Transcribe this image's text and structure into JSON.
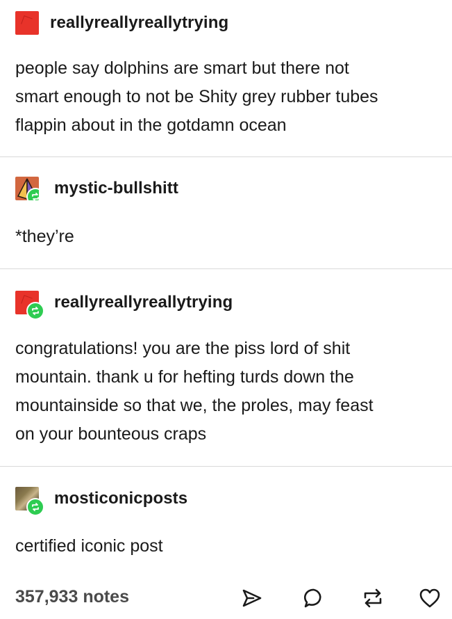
{
  "posts": [
    {
      "username": "reallyreallyreallytrying",
      "avatar": "red-square-avatar",
      "reblog": false,
      "lines": [
        "people say dolphins are smart but there not",
        "smart enough to not be Shity grey rubber tubes",
        "flappin about in the gotdamn ocean"
      ]
    },
    {
      "username": "mystic-bullshitt",
      "avatar": "pyramid-avatar",
      "reblog": true,
      "lines": [
        "*they’re"
      ]
    },
    {
      "username": "reallyreallyreallytrying",
      "avatar": "red-square-avatar",
      "reblog": true,
      "lines": [
        "congratulations! you are the piss lord of shit",
        "mountain. thank u for hefting turds down the",
        "mountainside so that we, the proles, may feast",
        "on your bounteous craps"
      ]
    },
    {
      "username": "mosticonicposts",
      "avatar": "photo-avatar",
      "reblog": true,
      "lines": [
        "certified iconic post"
      ]
    }
  ],
  "footer": {
    "notes": "357,933 notes",
    "actions": [
      "share-icon",
      "reply-icon",
      "reblog-icon",
      "like-icon"
    ]
  },
  "colors": {
    "reblog_badge": "#2ecc52",
    "avatar_red": "#e8332a",
    "divider": "#d9d9d9",
    "text": "#1a1a1a"
  }
}
